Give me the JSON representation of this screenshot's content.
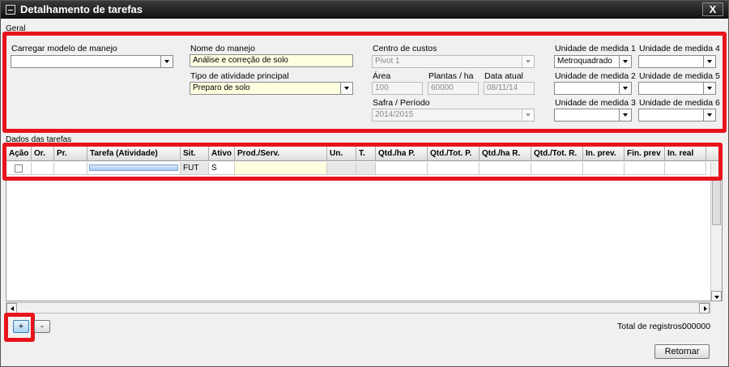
{
  "window": {
    "title": "Detalhamento de tarefas",
    "close_label": "X"
  },
  "geral": {
    "group_label": "Geral",
    "carregar_modelo": {
      "label": "Carregar modelo de manejo",
      "value": ""
    },
    "nome_manejo": {
      "label": "Nome do manejo",
      "value": "Análise e correção de solo"
    },
    "tipo_atividade": {
      "label": "Tipo de atividade principal",
      "value": "Preparo de solo"
    },
    "centro_custos": {
      "label": "Centro de custos",
      "value": "Pivot 1"
    },
    "area": {
      "label": "Área",
      "value": "100"
    },
    "plantas_ha": {
      "label": "Plantas / ha",
      "value": "60000"
    },
    "data_atual": {
      "label": "Data atual",
      "value": "08/11/14"
    },
    "safra": {
      "label": "Safra / Período",
      "value": "2014/2015"
    },
    "unidades": [
      {
        "label": "Unidade de medida 1",
        "value": "Metroquadrado"
      },
      {
        "label": "Unidade de medida 2",
        "value": ""
      },
      {
        "label": "Unidade de medida 3",
        "value": ""
      },
      {
        "label": "Unidade de medida 4",
        "value": ""
      },
      {
        "label": "Unidade de medida 5",
        "value": ""
      },
      {
        "label": "Unidade de medida 6",
        "value": ""
      }
    ]
  },
  "tarefas": {
    "group_label": "Dados das tarefas",
    "columns": [
      "Ação",
      "Or.",
      "Pr.",
      "Tarefa (Atividade)",
      "Sit.",
      "Ativo",
      "Prod./Serv.",
      "Un.",
      "T.",
      "Qtd./ha P.",
      "Qtd./Tot. P.",
      "Qtd./ha  R.",
      "Qtd./Tot. R.",
      "In. prev.",
      "Fin. prev",
      "In. real"
    ],
    "rows": [
      {
        "situacao": "FUT",
        "ativo": "S"
      }
    ]
  },
  "footer": {
    "add_label": "+",
    "remove_label": "-",
    "total_label": "Total de registros:",
    "total_value": "000000",
    "retornar_label": "Retornar"
  },
  "colors": {
    "highlight": "#e8141b",
    "yellow_field": "#ffffe0"
  }
}
